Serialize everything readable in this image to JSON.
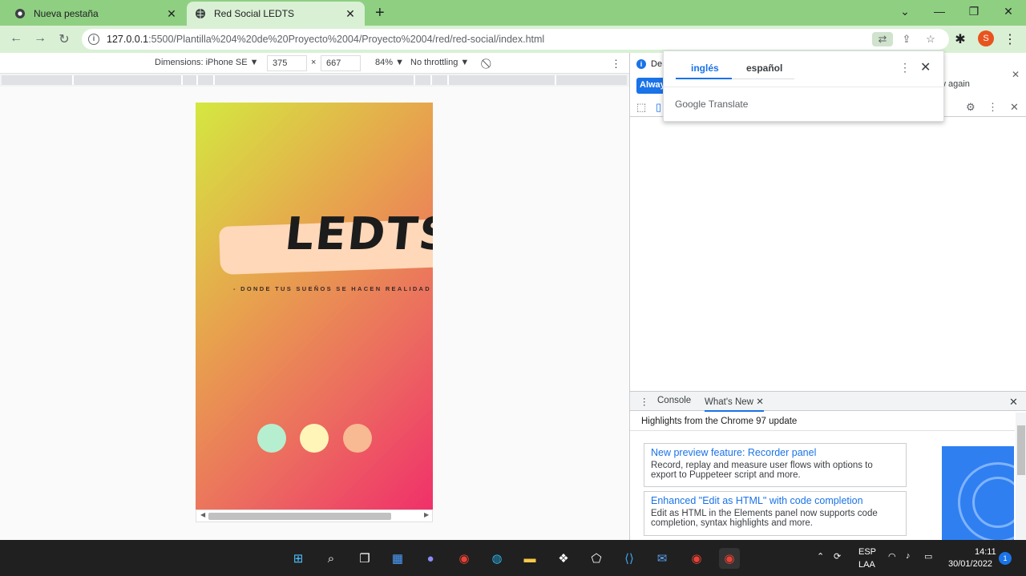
{
  "tabs": [
    {
      "label": "Nueva pestaña",
      "icon": "chrome-icon"
    },
    {
      "label": "Red Social LEDTS",
      "icon": "globe-icon"
    }
  ],
  "address": {
    "host": "127.0.0.1",
    "path": ":5500/Plantilla%204%20de%20Proyecto%2004/Proyecto%2004/red/red-social/index.html"
  },
  "profile_initial": "S",
  "device_toolbar": {
    "dimensions": "Dimensions: iPhone SE ▼",
    "width": "375",
    "x": "×",
    "height": "667",
    "zoom": "84% ▼",
    "throttling": "No throttling ▼"
  },
  "site": {
    "logo": "LEDTS",
    "tagline": "- DONDE TUS SUEÑOS SE HACEN REALIDAD",
    "dots": [
      {
        "color": "#b6efcf"
      },
      {
        "color": "#fff5b8"
      },
      {
        "color": "#f7ba92"
      }
    ]
  },
  "devtools": {
    "infobar_text": "De",
    "always_label": "Alway",
    "again_label": "w again",
    "drawer_tabs": [
      "Console",
      "What's New"
    ],
    "highlights": "Highlights from the Chrome 97 update",
    "cards": [
      {
        "title": "New preview feature: Recorder panel",
        "desc": "Record, replay and measure user flows with options to export to Puppeteer script and more."
      },
      {
        "title": "Enhanced \"Edit as HTML\" with code completion",
        "desc": "Edit as HTML in the Elements panel now supports code completion, syntax highlights and more."
      }
    ]
  },
  "translate": {
    "lang_en": "inglés",
    "lang_es": "español",
    "google": "Google",
    "translate": "Translate"
  },
  "taskbar": {
    "lang_top": "ESP",
    "lang_bottom": "LAA",
    "time": "14:11",
    "date": "30/01/2022",
    "notifications": "1"
  }
}
